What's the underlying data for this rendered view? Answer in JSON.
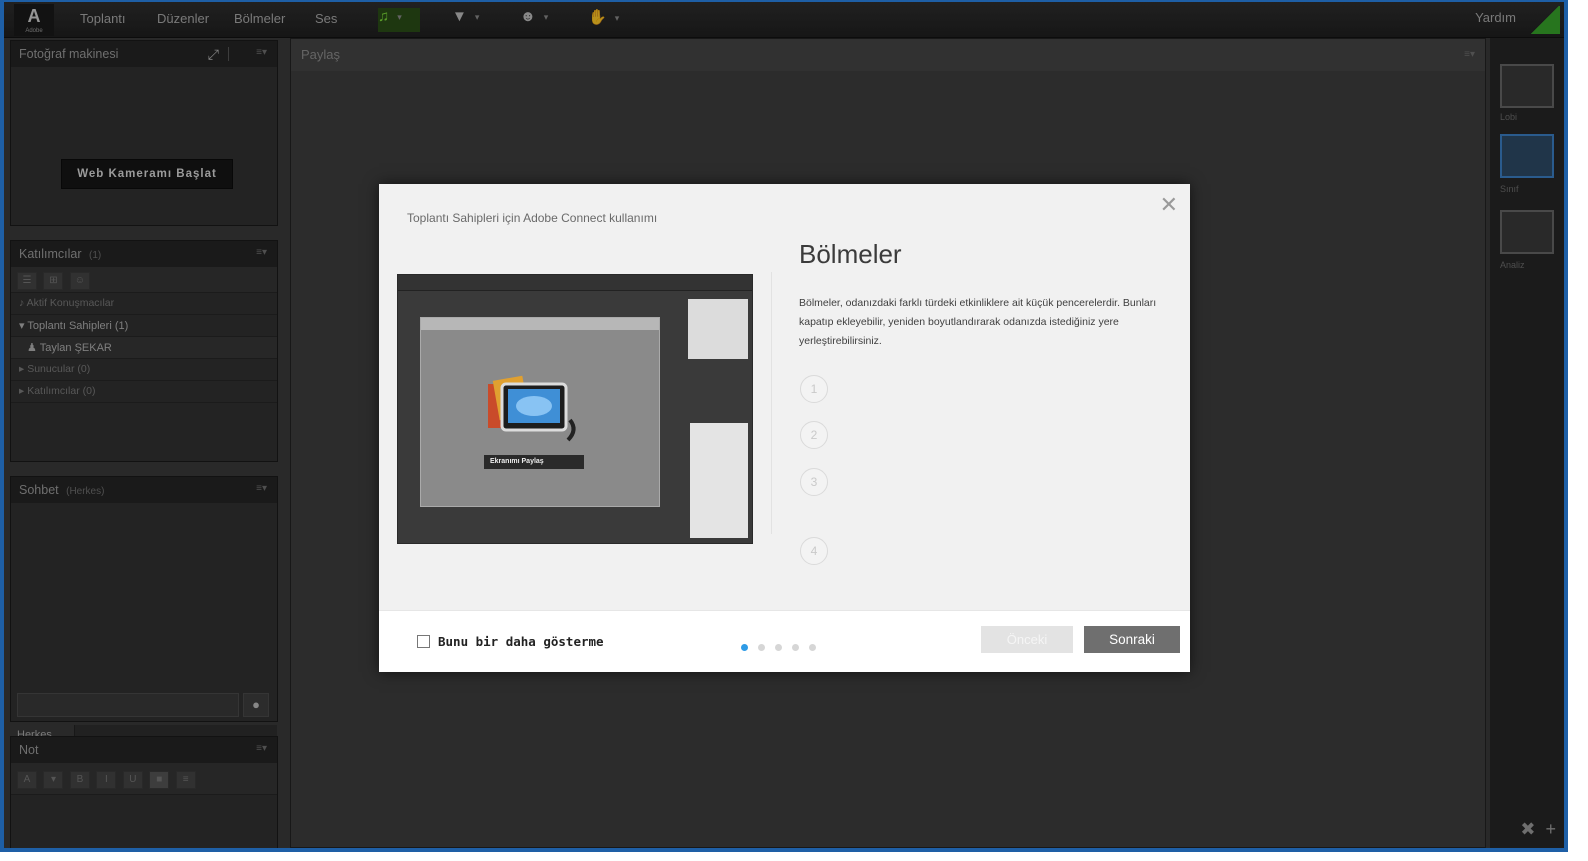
{
  "menubar": {
    "logo": "A",
    "logo_sub": "Adobe",
    "items": [
      "Toplantı",
      "Düzenler",
      "Bölmeler",
      "Ses"
    ],
    "help": "Yardım"
  },
  "camera_pod": {
    "title": "Fotoğraf makinesi",
    "start_button": "Web Kameramı Başlat"
  },
  "attendees_pod": {
    "title": "Katılımcılar",
    "count": "(1)",
    "active_speakers": "Aktif Konuşmacılar",
    "hosts_group": "Toplantı Sahipleri (1)",
    "host_name": "Taylan ŞEKAR",
    "presenters_group": "Sunucular (0)",
    "participants_group": "Katılımcılar (0)"
  },
  "chat_pod": {
    "title": "Sohbet",
    "subtitle": "(Herkes)",
    "tab": "Herkes"
  },
  "note_pod": {
    "title": "Not"
  },
  "share_pod": {
    "title": "Paylaş"
  },
  "layouts": {
    "items": [
      "Lobi",
      "Sınıf",
      "Analiz"
    ]
  },
  "dialog": {
    "subtitle": "Toplantı Sahipleri için Adobe Connect kullanımı",
    "title": "Bölmeler",
    "body": "Bölmeler, odanızdaki farklı türdeki etkinliklere ait küçük pencerelerdir. Bunları kapatıp ekleyebilir, yeniden boyutlandırarak odanızda istediğiniz yere yerleştirebilirsiniz.",
    "steps": [
      "1",
      "2",
      "3",
      "4"
    ],
    "illustration_button": "Ekranımı Paylaş",
    "dont_show": "Bunu bir daha gösterme",
    "prev": "Önceki",
    "next": "Sonraki",
    "page_dots": 5,
    "current_page": 1
  },
  "colors": {
    "accent": "#2e9be6",
    "frame": "#1e5fa6",
    "audio_active": "#2a4d17"
  }
}
